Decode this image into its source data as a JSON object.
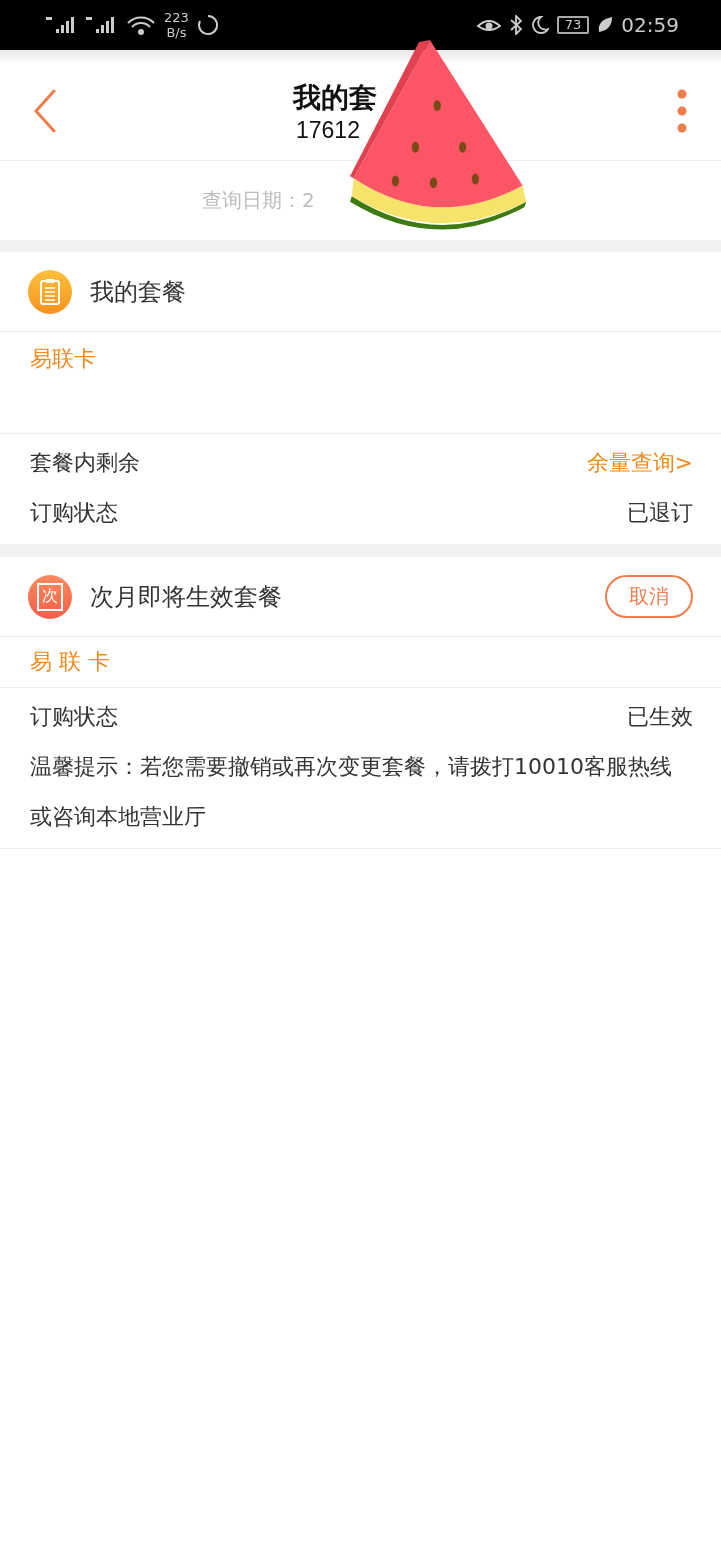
{
  "status_bar": {
    "speed_value": "223",
    "speed_unit": "B/s",
    "battery": "73",
    "time": "02:59"
  },
  "header": {
    "title": "我的套",
    "subtitle": "17612"
  },
  "query_date": "查询日期：2",
  "sections": [
    {
      "kind": "current",
      "title": "我的套餐",
      "plan": "易联卡",
      "rows": [
        {
          "kind": "link",
          "label": "套餐内剩余",
          "value": "余量查询>"
        },
        {
          "kind": "text",
          "label": "订购状态",
          "value": "已退订"
        }
      ]
    },
    {
      "kind": "next",
      "icon_label": "次",
      "title": "次月即将生效套餐",
      "action": "取消",
      "plan": "易 联 卡",
      "rows": [
        {
          "kind": "text",
          "label": "订购状态",
          "value": "已生效"
        }
      ],
      "note": "温馨提示：若您需要撤销或再次变更套餐，请拨打10010客服热线或咨询本地营业厅"
    }
  ]
}
